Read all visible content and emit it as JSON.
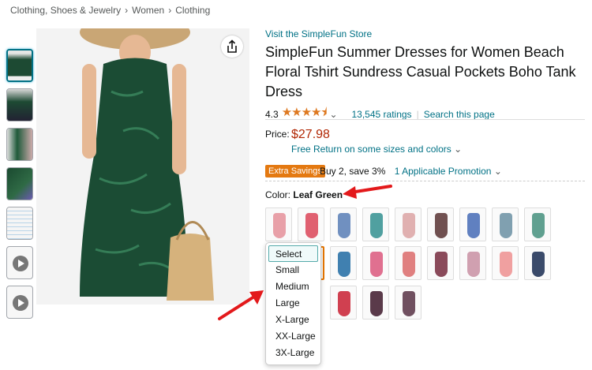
{
  "breadcrumb": [
    "Clothing, Shoes & Jewelry",
    "Women",
    "Clothing"
  ],
  "store_link": "Visit the SimpleFun Store",
  "title": "SimpleFun Summer Dresses for Women Beach Floral Tshirt Sundress Casual Pockets Boho Tank Dress",
  "rating": {
    "value": "4.3",
    "stars": "★★★★⯨",
    "ratings_text": "13,545 ratings",
    "search_text": "Search this page"
  },
  "price": {
    "label": "Price:",
    "value": "$27.98",
    "free_return": "Free Return on some sizes and colors"
  },
  "promo": {
    "badge": "Extra Savings",
    "text": "Buy 2, save 3%",
    "applicable": "1 Applicable Promotion"
  },
  "color": {
    "label": "Color:",
    "value": "Leaf Green"
  },
  "size_dropdown": {
    "options": [
      "Select",
      "Small",
      "Medium",
      "Large",
      "X-Large",
      "XX-Large",
      "3X-Large"
    ],
    "selected": "Select"
  },
  "swatch_colors": [
    "#e8a0a8",
    "#e06070",
    "#7090c0",
    "#50a0a0",
    "#e0b0b0",
    "#705050",
    "#6080c0",
    "#80a0b0",
    "#60a090",
    "#205a3a",
    "#4080b0",
    "#e07090",
    "#e08080",
    "#8a4a5a",
    "#d0a0b0",
    "#f0a0a0",
    "#3a4a6a",
    "#d04050",
    "#5a3a4a",
    "#705060"
  ],
  "accent_colors": {
    "link": "#007185",
    "price": "#b12704",
    "star": "#de7921",
    "badge": "#e47911",
    "arrow": "#e3191b"
  }
}
